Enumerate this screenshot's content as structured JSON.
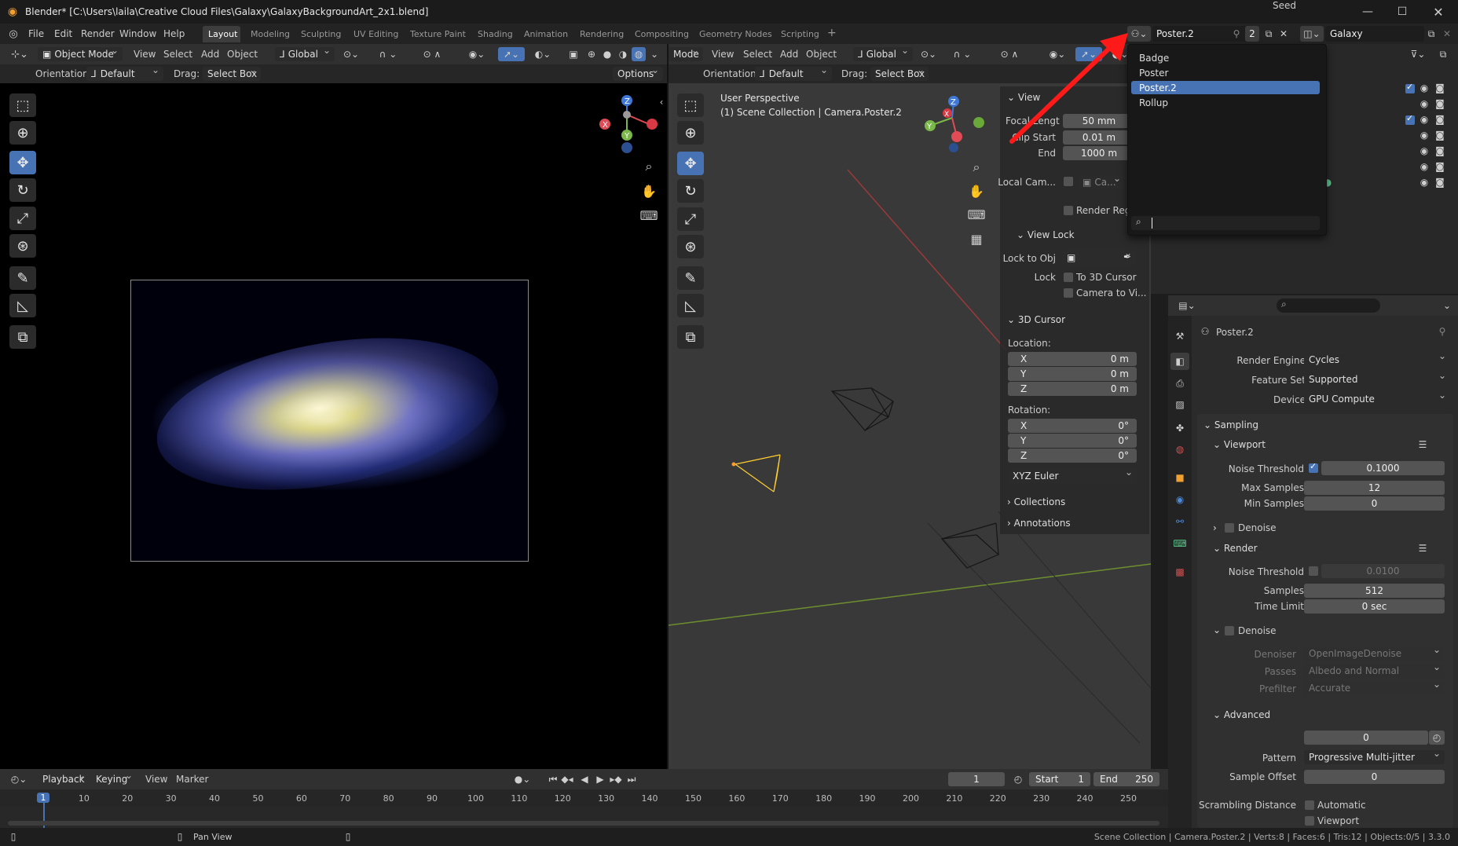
{
  "window": {
    "title": "Blender* [C:\\Users\\laila\\Creative Cloud Files\\Galaxy\\GalaxyBackgroundArt_2x1.blend]"
  },
  "menu": {
    "file": "File",
    "edit": "Edit",
    "render": "Render",
    "window": "Window",
    "help": "Help"
  },
  "workspaces": [
    "Layout",
    "Modeling",
    "Sculpting",
    "UV Editing",
    "Texture Paint",
    "Shading",
    "Animation",
    "Rendering",
    "Compositing",
    "Geometry Nodes",
    "Scripting",
    "+"
  ],
  "left_header": {
    "mode": "Object Mode",
    "view": "View",
    "select": "Select",
    "add": "Add",
    "object": "Object",
    "transform": "Global"
  },
  "left_subheader": {
    "orientation_label": "Orientation:",
    "orientation": "Default",
    "drag_label": "Drag:",
    "drag": "Select Box",
    "options": "Options"
  },
  "mid_header": {
    "mode": "Mode",
    "view": "View",
    "select": "Select",
    "add": "Add",
    "object": "Object",
    "transform": "Global"
  },
  "mid_subheader": {
    "orientation_label": "Orientation:",
    "orientation": "Default",
    "drag_label": "Drag:",
    "drag": "Select Box"
  },
  "viewport": {
    "line1": "User Perspective",
    "line2": "(1) Scene Collection | Camera.Poster.2"
  },
  "npanel": {
    "view_header": "View",
    "focal_label": "Focal Lengt",
    "focal": "50 mm",
    "clip_start_label": "Clip Start",
    "clip_start": "0.01 m",
    "end_label": "End",
    "end": "1000 m",
    "local_cam_label": "Local Cam...",
    "local_cam": "Ca...",
    "render_region": "Render Regio",
    "view_lock": "View Lock",
    "lock_obj_label": "Lock to Obj",
    "lock_label": "Lock",
    "to_cursor": "To 3D Cursor",
    "camera_to_view": "Camera to Vi...",
    "cursor_header": "3D Cursor",
    "location_label": "Location:",
    "loc": [
      {
        "axis": "X",
        "value": "0 m"
      },
      {
        "axis": "Y",
        "value": "0 m"
      },
      {
        "axis": "Z",
        "value": "0 m"
      }
    ],
    "rotation_label": "Rotation:",
    "rot": [
      {
        "axis": "X",
        "value": "0°"
      },
      {
        "axis": "Y",
        "value": "0°"
      },
      {
        "axis": "Z",
        "value": "0°"
      }
    ],
    "rotation_mode": "XYZ Euler",
    "collections": "Collections",
    "annotations": "Annotations"
  },
  "scene_header": {
    "scene": "Poster.2",
    "users": "2",
    "view_layer": "Galaxy"
  },
  "scene_dropdown": {
    "items": [
      "Badge",
      "Poster",
      "Poster.2",
      "Rollup"
    ],
    "selected_index": 2,
    "search_placeholder": ""
  },
  "properties": {
    "scene_name": "Poster.2",
    "render_engine_label": "Render Engine",
    "render_engine": "Cycles",
    "feature_set_label": "Feature Set",
    "feature_set": "Supported",
    "device_label": "Device",
    "device": "GPU Compute",
    "sampling": "Sampling",
    "viewport": "Viewport",
    "vp_noise_label": "Noise Threshold",
    "vp_noise": "0.1000",
    "vp_max_label": "Max Samples",
    "vp_max": "12",
    "vp_min_label": "Min Samples",
    "vp_min": "0",
    "denoise": "Denoise",
    "render": "Render",
    "r_noise_label": "Noise Threshold",
    "r_noise": "0.0100",
    "r_samples_label": "Samples",
    "r_samples": "512",
    "r_time_label": "Time Limit",
    "r_time": "0 sec",
    "r_denoise": "Denoise",
    "denoiser_label": "Denoiser",
    "denoiser": "OpenImageDenoise",
    "passes_label": "Passes",
    "passes": "Albedo and Normal",
    "prefilter_label": "Prefilter",
    "prefilter": "Accurate",
    "advanced": "Advanced",
    "seed_label": "Seed",
    "seed": "0",
    "pattern_label": "Pattern",
    "pattern": "Progressive Multi-jitter",
    "sample_offset_label": "Sample Offset",
    "sample_offset": "0",
    "scrambling_label": "Scrambling Distance",
    "automatic": "Automatic",
    "viewport2": "Viewport"
  },
  "timeline": {
    "playback": "Playback",
    "keying": "Keying",
    "view": "View",
    "marker": "Marker",
    "current": "1",
    "start_label": "Start",
    "start": "1",
    "end_label": "End",
    "end": "250",
    "ticks": [
      "1",
      "10",
      "20",
      "30",
      "40",
      "50",
      "60",
      "70",
      "80",
      "90",
      "100",
      "110",
      "120",
      "130",
      "140",
      "150",
      "160",
      "170",
      "180",
      "190",
      "200",
      "210",
      "220",
      "230",
      "240",
      "250"
    ]
  },
  "statusbar": {
    "pan": "Pan View",
    "info": "Scene Collection | Camera.Poster.2 | Verts:8 | Faces:6 | Tris:12 | Objects:0/5 | 3.3.0"
  },
  "colors": {
    "accent": "#4772b3",
    "annotation_arrow": "#ff1a1a"
  }
}
